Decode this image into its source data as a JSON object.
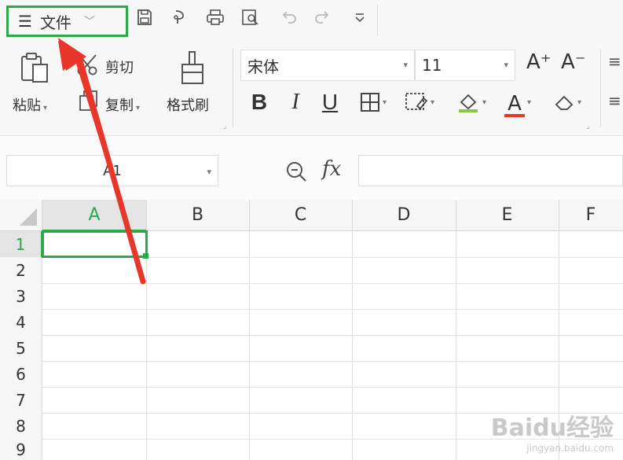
{
  "titlebar": {
    "file_menu_label": "文件",
    "quick_access": [
      "save-icon",
      "format-painter-quick-icon",
      "print-icon",
      "print-preview-icon",
      "undo-icon",
      "redo-icon",
      "customize-dropdown-icon"
    ]
  },
  "ribbon": {
    "paste_label": "粘贴",
    "cut_label": "剪切",
    "copy_label": "复制",
    "format_painter_label": "格式刷",
    "font_name": "宋体",
    "font_size": "11",
    "bold_label": "B",
    "italic_label": "I",
    "underline_label": "U",
    "font_color_label": "A",
    "font_increase_label": "A⁺",
    "font_decrease_label": "A⁻"
  },
  "formula_bar": {
    "name_box": "A1",
    "zoom_icon": "zoom-formula-icon",
    "fx_label": "fx",
    "formula_value": ""
  },
  "grid": {
    "columns": [
      "A",
      "B",
      "C",
      "D",
      "E",
      "F"
    ],
    "rows": [
      "1",
      "2",
      "3",
      "4",
      "5",
      "6",
      "7",
      "8",
      "9"
    ],
    "selected_cell": "A1"
  },
  "watermark": {
    "brand": "Baidu经验",
    "url": "jingyan.baidu.com"
  },
  "colors": {
    "accent_green": "#2aa84a",
    "annotation_red": "#e8362a"
  }
}
